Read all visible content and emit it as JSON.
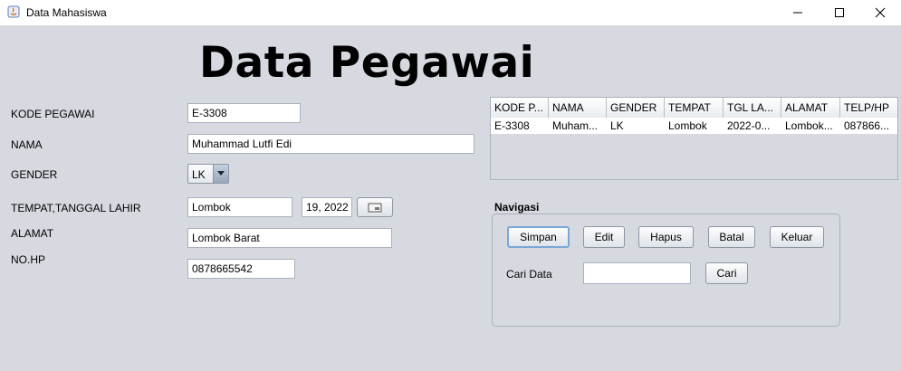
{
  "window": {
    "title": "Data Mahasiswa",
    "controls": [
      "minimize-icon",
      "maximize-icon",
      "close-icon"
    ]
  },
  "heading": "Data Pegawai",
  "form": {
    "kode": {
      "label": "KODE PEGAWAI",
      "value": "E-3308"
    },
    "nama": {
      "label": "NAMA",
      "value": "Muhammad Lutfi Edi"
    },
    "gender": {
      "label": "GENDER",
      "value": "LK"
    },
    "ttl": {
      "label": "TEMPAT,TANGGAL LAHIR",
      "tempat": "Lombok",
      "tanggal": "19, 2022",
      "calendar_icon": "calendar-icon"
    },
    "alamat": {
      "label": "ALAMAT",
      "value": "Lombok Barat"
    },
    "hp": {
      "label": "NO.HP",
      "value": "0878665542"
    }
  },
  "table": {
    "headers": [
      "KODE P...",
      "NAMA",
      "GENDER",
      "TEMPAT",
      "TGL LA...",
      "ALAMAT",
      "TELP/HP"
    ],
    "rows": [
      [
        "E-3308",
        "Muham...",
        "LK",
        "Lombok",
        "2022-0...",
        "Lombok...",
        "087866..."
      ]
    ]
  },
  "navigasi": {
    "title": "Navigasi",
    "buttons": {
      "simpan": "Simpan",
      "edit": "Edit",
      "hapus": "Hapus",
      "batal": "Batal",
      "keluar": "Keluar"
    },
    "search": {
      "label": "Cari Data",
      "value": "",
      "button": "Cari"
    }
  }
}
